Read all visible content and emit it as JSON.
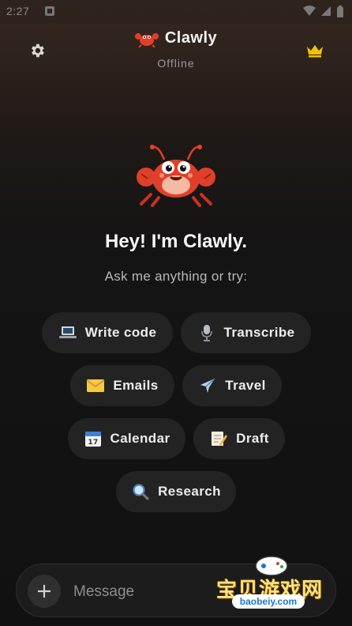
{
  "status_bar": {
    "time": "2:27"
  },
  "header": {
    "title": "Clawly",
    "subtitle": "Offline"
  },
  "main": {
    "greeting": "Hey! I'm Clawly.",
    "hint": "Ask me anything or try:",
    "suggestions": [
      {
        "label": "Write code",
        "icon": "laptop-icon"
      },
      {
        "label": "Transcribe",
        "icon": "microphone-icon"
      },
      {
        "label": "Emails",
        "icon": "envelope-icon"
      },
      {
        "label": "Travel",
        "icon": "airplane-icon"
      },
      {
        "label": "Calendar",
        "icon": "calendar-icon"
      },
      {
        "label": "Draft",
        "icon": "memo-icon"
      },
      {
        "label": "Research",
        "icon": "magnifier-icon"
      }
    ]
  },
  "composer": {
    "placeholder": "Message"
  },
  "watermark": {
    "text": "宝贝游戏网",
    "url": "baobeiy.com"
  },
  "colors": {
    "accent_crown": "#f2c200",
    "crab_red": "#e0402a",
    "chip_bg": "#232323"
  }
}
